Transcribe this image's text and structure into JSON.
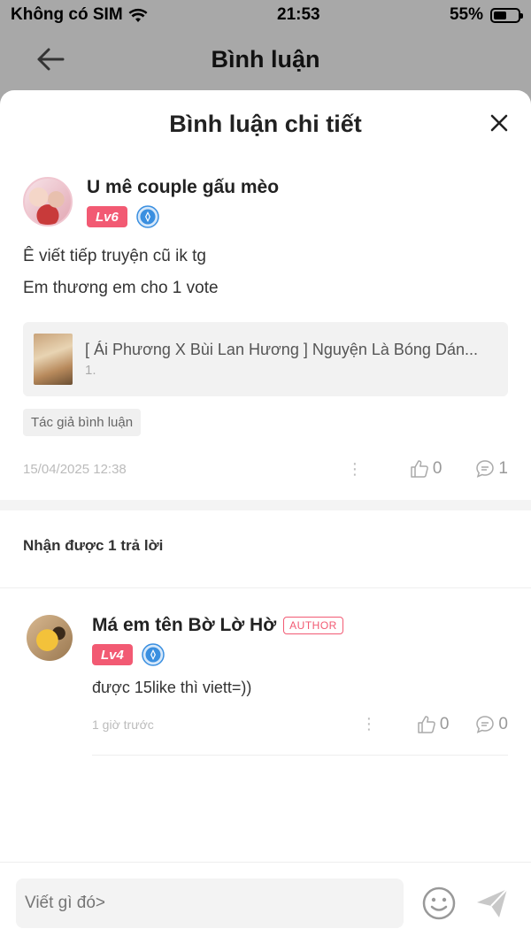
{
  "status_bar": {
    "carrier": "Không có SIM",
    "time": "21:53",
    "battery": "55%",
    "battery_level": 0.55
  },
  "nav": {
    "title": "Bình luận",
    "back_icon": "arrow-left-icon"
  },
  "sheet": {
    "title": "Bình luận chi tiết",
    "close_icon": "close-icon"
  },
  "comment": {
    "author": "U mê couple gấu mèo",
    "level": "Lv6",
    "lines": [
      "Ê viết tiếp truyện cũ ik tg",
      "Em thương em cho 1 vote"
    ],
    "story": {
      "title": "[ Ái Phương X Bùi Lan Hương ] Nguyện Là Bóng Dán...",
      "chapter": "1."
    },
    "tag": "Tác giả bình luận",
    "date": "15/04/2025 12:38",
    "likes": "0",
    "replies": "1"
  },
  "replies_header": "Nhận được 1 trả lời",
  "reply": {
    "author": "Má em tên Bờ Lờ Hờ",
    "author_tag": "AUTHOR",
    "level": "Lv4",
    "text": "được 15like thì viett=))",
    "time": "1 giờ trước",
    "likes": "0",
    "replies": "0"
  },
  "input": {
    "placeholder": "Viết gì đó>"
  },
  "colors": {
    "accent": "#f25a73",
    "badge_blue": "#3a8fe0",
    "overlay": "#a8a8a8"
  }
}
